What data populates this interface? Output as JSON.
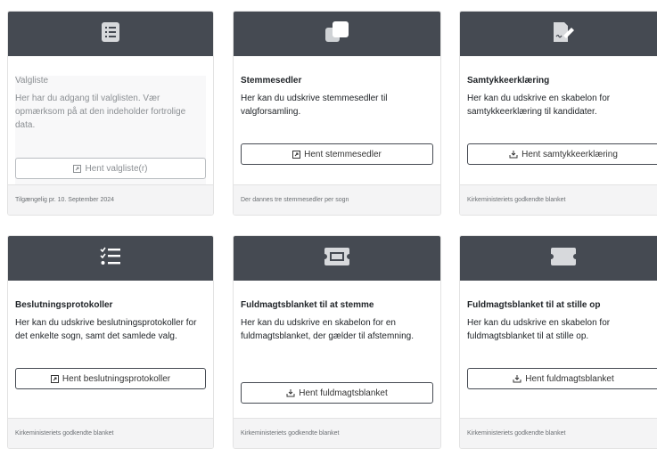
{
  "cards": [
    {
      "title": "Valgliste",
      "description": "Her har du adgang til valglisten. Vær opmærksom på at den indeholder fortrolige data.",
      "button_label": "Hent valgliste(r)",
      "footer": "Tilgængelig pr. 10. September 2024",
      "icon": "list-icon",
      "button_icon": "open-external-icon"
    },
    {
      "title": "Stemmesedler",
      "description": "Her kan du udskrive stemmesedler til valgforsamling.",
      "button_label": "Hent stemmesedler",
      "footer": "Der dannes tre stemmesedler per sogn",
      "icon": "ballots-icon",
      "button_icon": "open-external-icon"
    },
    {
      "title": "Samtykkeerklæring",
      "description": "Her kan du udskrive en skabelon for samtykkeerklæring til kandidater.",
      "button_label": "Hent samtykkeerklæring",
      "footer": "Kirkeministeriets godkendte blanket",
      "icon": "signed-document-icon",
      "button_icon": "download-icon"
    },
    {
      "title": "Beslutningsprotokoller",
      "description": "Her kan du udskrive beslutningsprotokoller for det enkelte sogn, samt det samlede valg.",
      "button_label": "Hent beslutningsprotokoller",
      "footer": "Kirkeministeriets godkendte blanket",
      "icon": "checklist-icon",
      "button_icon": "open-external-icon"
    },
    {
      "title": "Fuldmagtsblanket til at stemme",
      "description": "Her kan du udskrive en skabelon for en fuldmagtsblanket, der gælder til afstemning.",
      "button_label": "Hent fuldmagtsblanket",
      "footer": "Kirkeministeriets godkendte blanket",
      "icon": "ticket-icon",
      "button_icon": "download-icon"
    },
    {
      "title": "Fuldmagtsblanket til at stille op",
      "description": "Her kan du udskrive en skabelon for fuldmagtsblanket til at stille op.",
      "button_label": "Hent fuldmagtsblanket",
      "footer": "Kirkeministeriets godkendte blanket",
      "icon": "ticket-icon",
      "button_icon": "download-icon"
    }
  ],
  "colors": {
    "header": "#454a52",
    "footer_bg": "#f4f4f5",
    "border": "#e3e3e3"
  }
}
